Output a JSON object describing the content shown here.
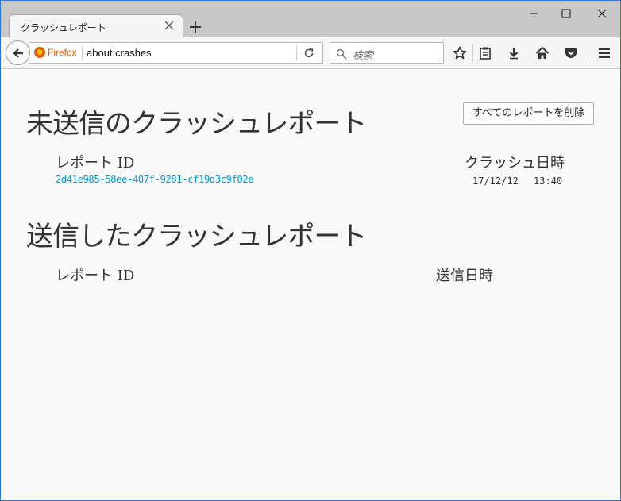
{
  "browser": {
    "tab": {
      "title": "クラッシュレポート"
    },
    "identity": {
      "label": "Firefox"
    },
    "url": "about:crashes",
    "search": {
      "placeholder": "検索"
    },
    "icons": {
      "close": "close-icon",
      "new_tab": "plus-icon",
      "back": "arrow-left-icon",
      "reload": "reload-icon",
      "search": "magnifier-icon",
      "bookmark": "star-icon",
      "reading_list": "clipboard-icon",
      "downloads": "download-icon",
      "home": "home-icon",
      "pocket": "pocket-icon",
      "menu": "hamburger-icon"
    },
    "colors": {
      "accent": "#e66000",
      "link": "#0096dd",
      "window_border": "#2b78d0"
    }
  },
  "page": {
    "unsubmitted": {
      "heading": "未送信のクラッシュレポート",
      "clear_button": "すべてのレポートを削除",
      "col_id": "レポート ID",
      "col_date": "クラッシュ日時",
      "reports": [
        {
          "id": "2d41e985-58ee-407f-9281-cf19d3c9f02e",
          "date": "17/12/12　 13:40"
        }
      ]
    },
    "submitted": {
      "heading": "送信したクラッシュレポート",
      "col_id": "レポート ID",
      "col_date": "送信日時"
    }
  }
}
